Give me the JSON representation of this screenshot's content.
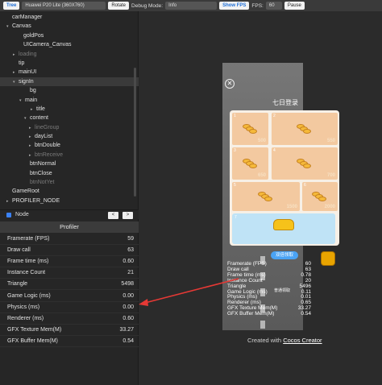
{
  "toolbar": {
    "tree_label": "Tree",
    "device": "Huawei P20 Lite (360X760)",
    "rotate_label": "Rotate",
    "debug_mode_label": "Debug Mode:",
    "debug_mode_value": "Info",
    "show_fps_label": "Show FPS",
    "fps_label": "FPS:",
    "fps_value": "60",
    "pause_label": "Pause"
  },
  "tree": {
    "items": [
      {
        "label": "carManager",
        "arrow": "",
        "dim": false
      },
      {
        "label": "Canvas",
        "arrow": "▾",
        "dim": false
      },
      {
        "label": "goldPos",
        "arrow": "",
        "dim": false
      },
      {
        "label": "UICamera_Canvas",
        "arrow": "",
        "dim": false
      },
      {
        "label": "loading",
        "arrow": "▸",
        "dim": true
      },
      {
        "label": "tip",
        "arrow": "",
        "dim": false
      },
      {
        "label": "mainUI",
        "arrow": "▸",
        "dim": false
      },
      {
        "label": "signIn",
        "arrow": "▾",
        "dim": false,
        "selected": true
      },
      {
        "label": "bg",
        "arrow": "",
        "dim": false
      },
      {
        "label": "main",
        "arrow": "▾",
        "dim": false
      },
      {
        "label": "title",
        "arrow": "▸",
        "dim": false
      },
      {
        "label": "content",
        "arrow": "▾",
        "dim": false
      },
      {
        "label": "lineGroup",
        "arrow": "▸",
        "dim": true
      },
      {
        "label": "dayList",
        "arrow": "▸",
        "dim": false
      },
      {
        "label": "btnDouble",
        "arrow": "▸",
        "dim": false
      },
      {
        "label": "btnReceive",
        "arrow": "▸",
        "dim": true
      },
      {
        "label": "btnNormal",
        "arrow": "",
        "dim": false
      },
      {
        "label": "btnClose",
        "arrow": "",
        "dim": false
      },
      {
        "label": "btnNotYet",
        "arrow": "",
        "dim": true
      },
      {
        "label": "GameRoot",
        "arrow": "",
        "dim": false
      },
      {
        "label": "PROFILER_NODE",
        "arrow": "▸",
        "dim": false
      }
    ]
  },
  "node_panel": {
    "label": "Node",
    "prev": "<",
    "next": ">"
  },
  "profiler": {
    "title": "Profiler",
    "rows": [
      {
        "label": "Framerate (FPS)",
        "value": "59"
      },
      {
        "label": "Draw call",
        "value": "63"
      },
      {
        "label": "Frame time (ms)",
        "value": "0.60"
      },
      {
        "label": "Instance Count",
        "value": "21"
      },
      {
        "label": "Triangle",
        "value": "5498"
      },
      {
        "label": "Game Logic (ms)",
        "value": "0.00"
      },
      {
        "label": "Physics (ms)",
        "value": "0.00"
      },
      {
        "label": "Renderer (ms)",
        "value": "0.60"
      },
      {
        "label": "GFX Texture Mem(M)",
        "value": "33.27"
      },
      {
        "label": "GFX Buffer Mem(M)",
        "value": "0.54"
      }
    ]
  },
  "game": {
    "dialog_title": "七日登录",
    "close": "✕",
    "cards": [
      {
        "num": "1",
        "amount": "500"
      },
      {
        "num": "2",
        "amount": "550"
      },
      {
        "num": "3",
        "amount": "650"
      },
      {
        "num": "4",
        "amount": "700"
      },
      {
        "num": "5",
        "amount": "1500"
      },
      {
        "num": "6",
        "amount": "2000"
      }
    ],
    "card7_num": "7",
    "double_button": "双倍领取",
    "normal_button": "普通领取",
    "stats": [
      {
        "label": "Framerate (FPS)",
        "value": "60"
      },
      {
        "label": "Draw call",
        "value": "63"
      },
      {
        "label": "Frame time (ms)",
        "value": "0.78"
      },
      {
        "label": "Instance Count",
        "value": "20"
      },
      {
        "label": "Triangle",
        "value": "5496"
      },
      {
        "label": "Game Logic (ms)",
        "value": "0.11"
      },
      {
        "label": "Physics (ms)",
        "value": "0.01"
      },
      {
        "label": "Renderer (ms)",
        "value": "0.65"
      },
      {
        "label": "GFX Texture Mem(M)",
        "value": "33.27"
      },
      {
        "label": "GFX Buffer Mem(M)",
        "value": "0.54"
      }
    ]
  },
  "footer": {
    "created_with": "Created with",
    "link": "Cocos Creator"
  },
  "colors": {
    "arrow": "#e53935",
    "accent": "#3b82f6"
  }
}
